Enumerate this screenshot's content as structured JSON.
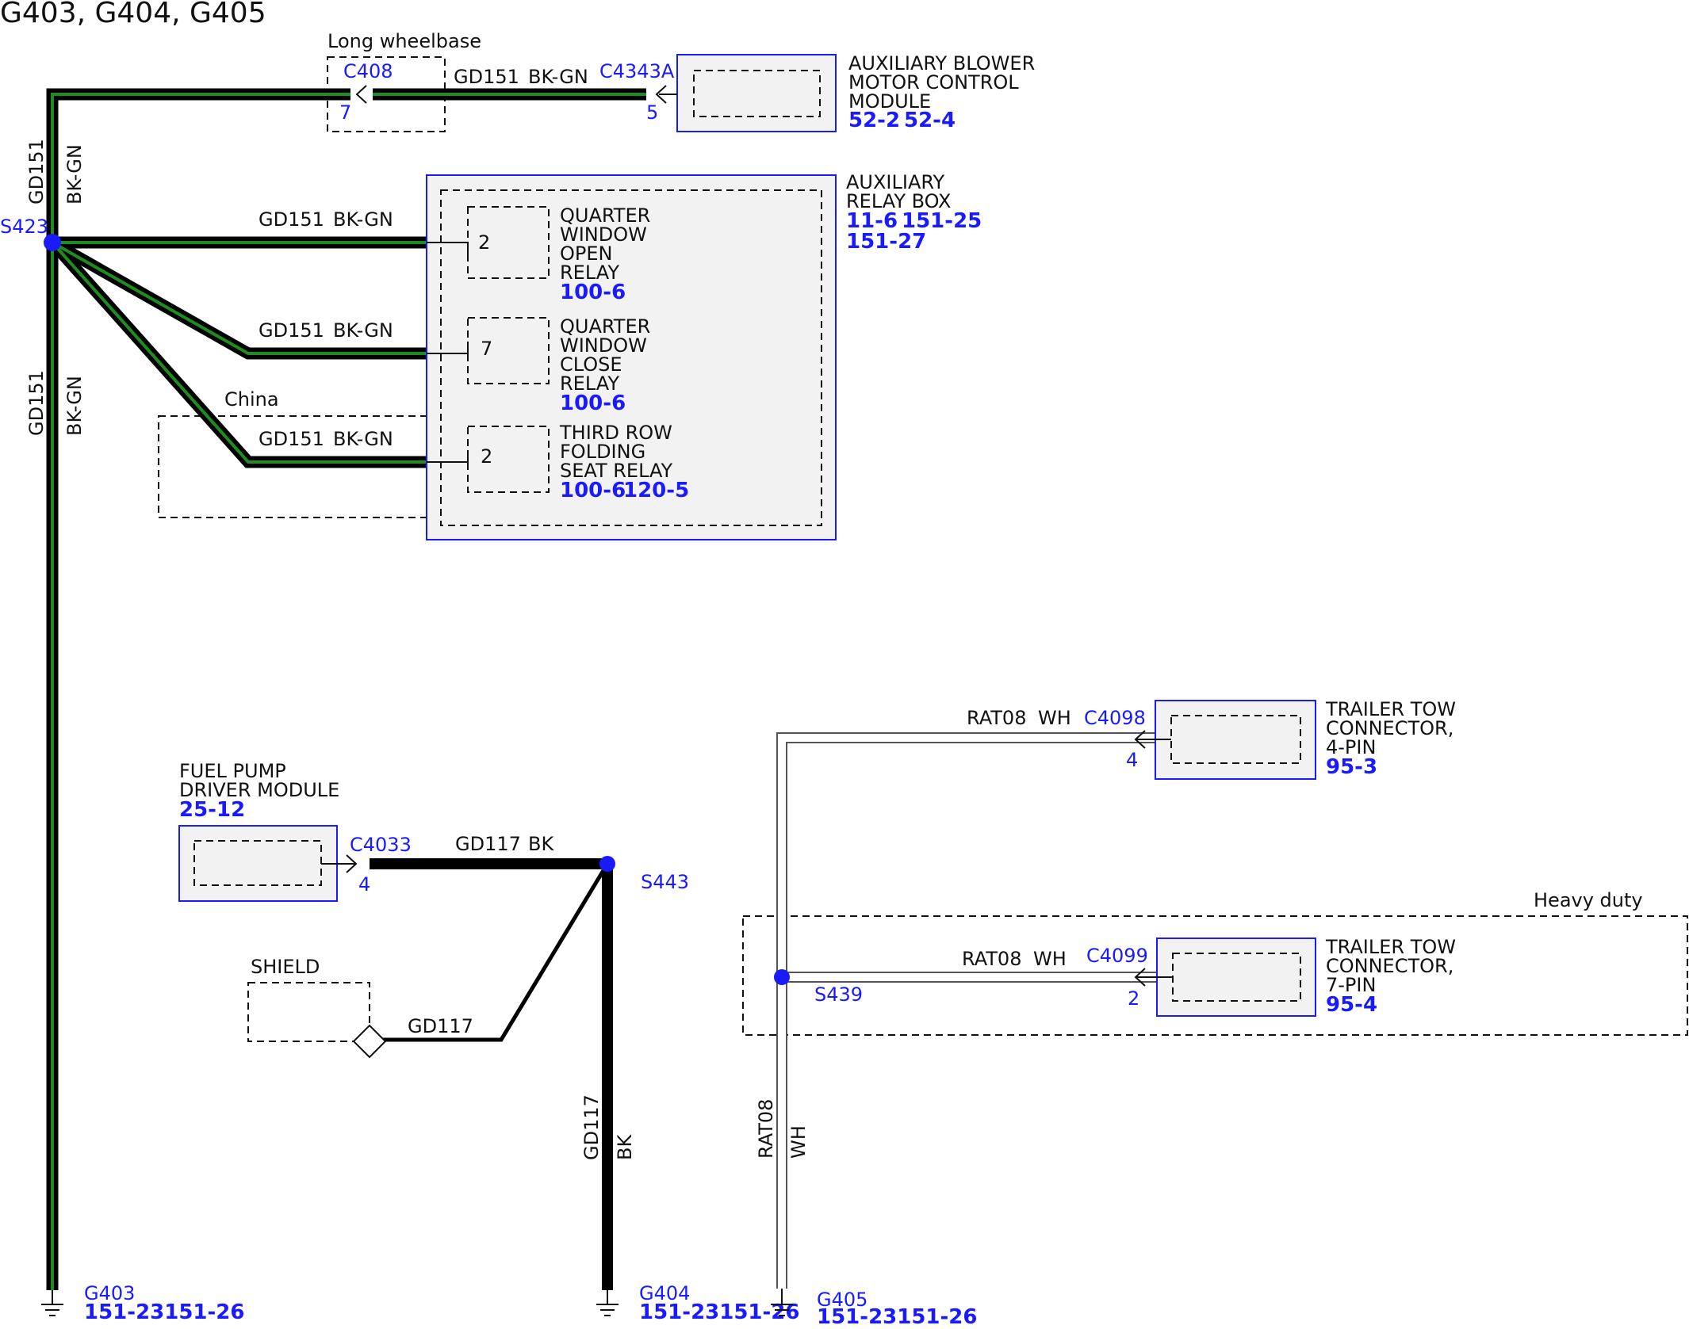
{
  "title": "G403, G404, G405",
  "options": {
    "long_wheelbase": "Long wheelbase",
    "china": "China",
    "heavy_duty": "Heavy duty"
  },
  "components": {
    "blower": {
      "lines": [
        "AUXILIARY BLOWER",
        "MOTOR CONTROL",
        "MODULE"
      ],
      "refs": [
        "52-2",
        "52-4"
      ]
    },
    "relay_box": {
      "lines": [
        "AUXILIARY",
        "RELAY BOX"
      ],
      "refs": [
        "11-6",
        "151-25",
        "151-27"
      ]
    },
    "relay_open": {
      "lines": [
        "QUARTER",
        "WINDOW",
        "OPEN",
        "RELAY"
      ],
      "refs": [
        "100-6"
      ],
      "pin": "2"
    },
    "relay_close": {
      "lines": [
        "QUARTER",
        "WINDOW",
        "CLOSE",
        "RELAY"
      ],
      "refs": [
        "100-6"
      ],
      "pin": "7"
    },
    "relay_third": {
      "lines": [
        "THIRD ROW",
        "FOLDING",
        "SEAT RELAY"
      ],
      "refs": [
        "100-6",
        "120-5"
      ],
      "pin": "2"
    },
    "fuel_pump": {
      "lines": [
        "FUEL PUMP",
        "DRIVER MODULE"
      ],
      "refs": [
        "25-12"
      ]
    },
    "shield": {
      "label": "SHIELD"
    },
    "trailer4": {
      "lines": [
        "TRAILER TOW",
        "CONNECTOR,",
        "4-PIN"
      ],
      "refs": [
        "95-3"
      ]
    },
    "trailer7": {
      "lines": [
        "TRAILER TOW",
        "CONNECTOR,",
        "7-PIN"
      ],
      "refs": [
        "95-4"
      ]
    }
  },
  "connectors": {
    "c408": {
      "id": "C408",
      "pin": "7"
    },
    "c4343a": {
      "id": "C4343A",
      "pin": "5"
    },
    "c4033": {
      "id": "C4033",
      "pin": "4"
    },
    "c4098": {
      "id": "C4098",
      "pin": "4"
    },
    "c4099": {
      "id": "C4099",
      "pin": "2"
    }
  },
  "splices": {
    "s423": "S423",
    "s443": "S443",
    "s439": "S439"
  },
  "wires": {
    "gd151": {
      "circuit": "GD151",
      "color": "BK-GN"
    },
    "gd117": {
      "circuit": "GD117",
      "color": "BK"
    },
    "rat08": {
      "circuit": "RAT08",
      "color": "WH"
    }
  },
  "grounds": {
    "g403": {
      "id": "G403",
      "refs": "151-23151-26"
    },
    "g404": {
      "id": "G404",
      "refs": "151-23151-26"
    },
    "g405": {
      "id": "G405",
      "refs": "151-23151-26"
    }
  },
  "colors": {
    "bk_gn_outer": "#000000",
    "bk_gn_inner": "#1f8c1f",
    "label_blue": "#1a1aff",
    "module_fill": "#f2f2f2",
    "wh_wire_edge": "#555555",
    "wh_wire_fill": "#ffffff"
  },
  "icons": [
    "ground-icon",
    "splice-icon",
    "connector-arrow-icon",
    "shield-termination-icon"
  ]
}
